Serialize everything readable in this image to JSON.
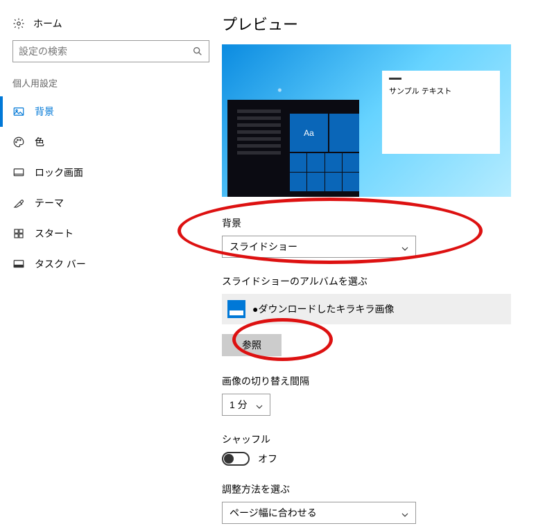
{
  "sidebar": {
    "home": "ホーム",
    "search_placeholder": "設定の検索",
    "section_label": "個人用設定",
    "items": [
      {
        "label": "背景"
      },
      {
        "label": "色"
      },
      {
        "label": "ロック画面"
      },
      {
        "label": "テーマ"
      },
      {
        "label": "スタート"
      },
      {
        "label": "タスク バー"
      }
    ]
  },
  "content": {
    "preview_heading": "プレビュー",
    "preview_tile_text": "Aa",
    "preview_window_text": "サンプル テキスト",
    "background_label": "背景",
    "background_value": "スライドショー",
    "album_label": "スライドショーのアルバムを選ぶ",
    "album_name": "●ダウンロードしたキラキラ画像",
    "browse_label": "参照",
    "interval_label": "画像の切り替え間隔",
    "interval_value": "1 分",
    "shuffle_label": "シャッフル",
    "shuffle_state": "オフ",
    "fit_label": "調整方法を選ぶ",
    "fit_value": "ページ幅に合わせる"
  }
}
